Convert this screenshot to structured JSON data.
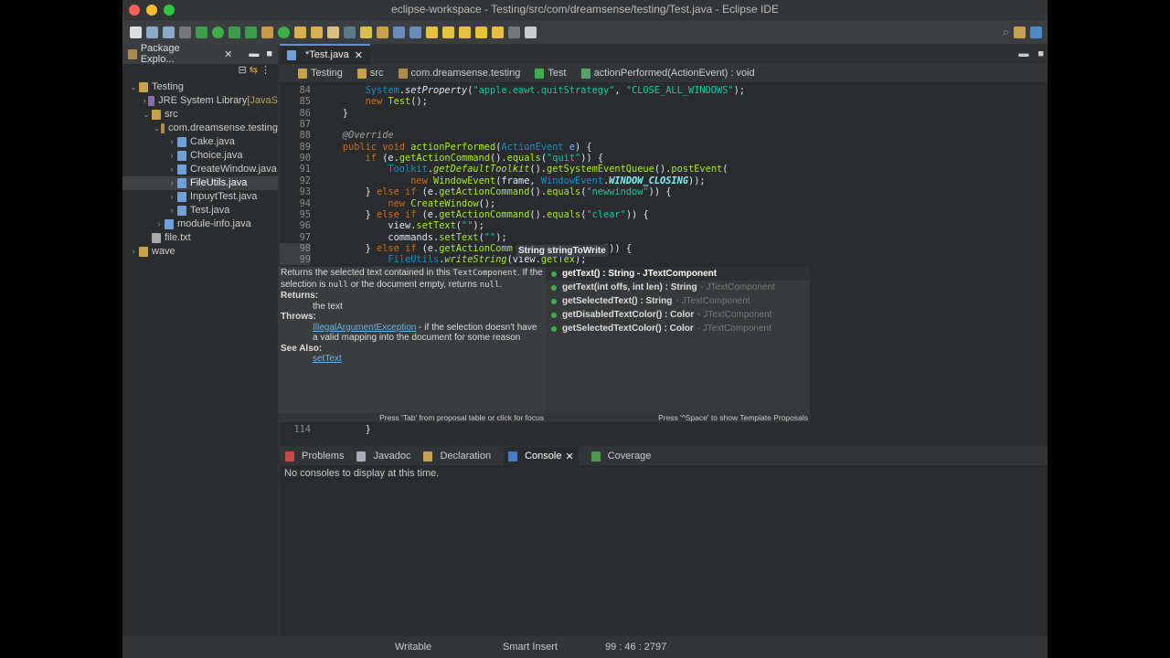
{
  "window": {
    "title": "eclipse-workspace - Testing/src/com/dreamsense/testing/Test.java - Eclipse IDE"
  },
  "package_explorer": {
    "title": "Package Explo...",
    "items": [
      {
        "label": "Testing",
        "depth": 0,
        "arrow": "v",
        "color": "#c8a14a"
      },
      {
        "label": "JRE System Library",
        "extra": " [JavaS",
        "depth": 1,
        "arrow": ">",
        "color": "#8a6fb0"
      },
      {
        "label": "src",
        "depth": 1,
        "arrow": "v",
        "color": "#c8a14a"
      },
      {
        "label": "com.dreamsense.testing",
        "depth": 2,
        "arrow": "v",
        "color": "#b08a4a"
      },
      {
        "label": "Cake.java",
        "depth": 3,
        "arrow": ">",
        "color": "#6fa0d8"
      },
      {
        "label": "Choice.java",
        "depth": 3,
        "arrow": ">",
        "color": "#6fa0d8"
      },
      {
        "label": "CreateWindow.java",
        "depth": 3,
        "arrow": ">",
        "color": "#6fa0d8"
      },
      {
        "label": "FileUtils.java",
        "depth": 3,
        "arrow": ">",
        "color": "#6fa0d8",
        "selected": true
      },
      {
        "label": "InpuytTest.java",
        "depth": 3,
        "arrow": ">",
        "color": "#6fa0d8"
      },
      {
        "label": "Test.java",
        "depth": 3,
        "arrow": ">",
        "color": "#6fa0d8"
      },
      {
        "label": "module-info.java",
        "depth": 2,
        "arrow": ">",
        "color": "#6fa0d8"
      },
      {
        "label": "file.txt",
        "depth": 1,
        "arrow": "",
        "color": "#aaa"
      },
      {
        "label": "wave",
        "depth": 0,
        "arrow": ">",
        "color": "#c8a14a"
      }
    ]
  },
  "editor": {
    "tab": "*Test.java",
    "breadcrumb": [
      "Testing",
      "src",
      "com.dreamsense.testing",
      "Test",
      "actionPerformed(ActionEvent) : void"
    ],
    "lines": [
      {
        "n": "84",
        "t": [
          [
            "        ",
            ""
          ],
          [
            "System",
            "t"
          ],
          [
            ".",
            ""
          ],
          [
            "setProperty",
            "i"
          ],
          [
            "(",
            ""
          ],
          [
            "\"apple.eawt.quitStrategy\"",
            "s"
          ],
          [
            ", ",
            ""
          ],
          [
            "\"CLOSE_ALL_WINDOWS\"",
            "s"
          ],
          [
            ");",
            ""
          ]
        ]
      },
      {
        "n": "85",
        "t": [
          [
            "        ",
            ""
          ],
          [
            "new ",
            "k"
          ],
          [
            "Test",
            "m"
          ],
          [
            "();",
            ""
          ]
        ]
      },
      {
        "n": "86",
        "t": [
          [
            "    }",
            ""
          ]
        ]
      },
      {
        "n": "87",
        "t": []
      },
      {
        "n": "88",
        "t": [
          [
            "    @Override",
            "a"
          ]
        ]
      },
      {
        "n": "89",
        "t": [
          [
            "    ",
            ""
          ],
          [
            "public void ",
            "k"
          ],
          [
            "actionPerformed",
            "m"
          ],
          [
            "(",
            ""
          ],
          [
            "ActionEvent ",
            "t"
          ],
          [
            "e",
            "v"
          ],
          [
            ") {",
            ""
          ]
        ]
      },
      {
        "n": "90",
        "t": [
          [
            "        ",
            ""
          ],
          [
            "if ",
            "k"
          ],
          [
            "(e.",
            ""
          ],
          [
            "getActionCommand",
            "m"
          ],
          [
            "().",
            ""
          ],
          [
            "equals",
            "m"
          ],
          [
            "(",
            ""
          ],
          [
            "\"quit\"",
            "s"
          ],
          [
            ")) {",
            ""
          ]
        ]
      },
      {
        "n": "91",
        "t": [
          [
            "            ",
            ""
          ],
          [
            "Toolkit",
            "t"
          ],
          [
            ".",
            ""
          ],
          [
            "getDefaultToolkit",
            "m i"
          ],
          [
            "().",
            ""
          ],
          [
            "getSystemEventQueue",
            "m"
          ],
          [
            "().",
            ""
          ],
          [
            "postEvent",
            "m"
          ],
          [
            "(",
            ""
          ]
        ]
      },
      {
        "n": "92",
        "t": [
          [
            "                ",
            ""
          ],
          [
            "new ",
            "k"
          ],
          [
            "WindowEvent",
            "m"
          ],
          [
            "(frame, ",
            ""
          ],
          [
            "WindowEvent",
            "t"
          ],
          [
            ".",
            ""
          ],
          [
            "WINDOW_CLOSING",
            "c"
          ],
          [
            "));",
            ""
          ]
        ]
      },
      {
        "n": "93",
        "t": [
          [
            "        } ",
            ""
          ],
          [
            "else if ",
            "k"
          ],
          [
            "(e.",
            ""
          ],
          [
            "getActionCommand",
            "m"
          ],
          [
            "().",
            ""
          ],
          [
            "equals",
            "m"
          ],
          [
            "(",
            ""
          ],
          [
            "\"newwindow\"",
            "s"
          ],
          [
            ")) {",
            ""
          ]
        ]
      },
      {
        "n": "94",
        "t": [
          [
            "            ",
            ""
          ],
          [
            "new ",
            "k"
          ],
          [
            "CreateWindow",
            "m"
          ],
          [
            "();",
            ""
          ]
        ]
      },
      {
        "n": "95",
        "t": [
          [
            "        } ",
            ""
          ],
          [
            "else if ",
            "k"
          ],
          [
            "(e.",
            ""
          ],
          [
            "getActionCommand",
            "m"
          ],
          [
            "().",
            ""
          ],
          [
            "equals",
            "m"
          ],
          [
            "(",
            ""
          ],
          [
            "\"clear\"",
            "s"
          ],
          [
            ")) {",
            ""
          ]
        ]
      },
      {
        "n": "96",
        "t": [
          [
            "            view.",
            ""
          ],
          [
            "setText",
            "m"
          ],
          [
            "(",
            ""
          ],
          [
            "\"\"",
            "s"
          ],
          [
            ");",
            ""
          ]
        ]
      },
      {
        "n": "97",
        "t": [
          [
            "            commands.",
            ""
          ],
          [
            "setText",
            "m"
          ],
          [
            "(",
            ""
          ],
          [
            "\"\"",
            "s"
          ],
          [
            ");",
            ""
          ]
        ]
      },
      {
        "n": "98",
        "t": [
          [
            "        } ",
            ""
          ],
          [
            "else if ",
            "k"
          ],
          [
            "(e.",
            ""
          ],
          [
            "getActionComm",
            "m"
          ],
          [
            "              ",
            ""
          ],
          [
            "ve\"",
            "s"
          ],
          [
            ")) {",
            ""
          ]
        ]
      },
      {
        "n": "99",
        "t": [
          [
            "            ",
            ""
          ],
          [
            "FileUtils",
            "t"
          ],
          [
            ".",
            ""
          ],
          [
            "writeString",
            "m i"
          ],
          [
            "(view.",
            ""
          ],
          [
            "getTex",
            "m"
          ],
          [
            ");",
            ""
          ]
        ]
      },
      {
        "n": "114",
        "t": [
          [
            "        }",
            ""
          ]
        ]
      }
    ],
    "param_hint": "String stringToWrite"
  },
  "javadoc_popup": {
    "summary_1": "Returns the selected text contained in this ",
    "code_1": "TextComponent",
    "summary_2": ". If the selection is ",
    "code_2": "null",
    "summary_3": " or the document empty, returns ",
    "code_3": "null",
    "summary_4": ".",
    "returns_label": "Returns:",
    "returns": "the text",
    "throws_label": "Throws:",
    "exception": "IllegalArgumentException",
    "throws_text": " - if the selection doesn't have a valid mapping into the document for some reason",
    "see_label": "See Also:",
    "see_link": "setText",
    "footer": "Press 'Tab' from proposal table or click for focus"
  },
  "proposals": {
    "items": [
      {
        "sig": "getText() : String - JTextComponent",
        "owner": ""
      },
      {
        "sig": "getText(int offs, int len) : String",
        "owner": "- JTextComponent"
      },
      {
        "sig": "getSelectedText() : String",
        "owner": "- JTextComponent"
      },
      {
        "sig": "getDisabledTextColor() : Color",
        "owner": "- JTextComponent"
      },
      {
        "sig": "getSelectedTextColor() : Color",
        "owner": "- JTextComponent"
      }
    ],
    "footer": "Press '^Space' to show Template Proposals"
  },
  "bottom_panel": {
    "tabs": [
      "Problems",
      "Javadoc",
      "Declaration",
      "Console",
      "Coverage"
    ],
    "active": "Console",
    "message": "No consoles to display at this time."
  },
  "status": {
    "mode": "Writable",
    "insert": "Smart Insert",
    "position": "99 : 46 : 2797"
  }
}
